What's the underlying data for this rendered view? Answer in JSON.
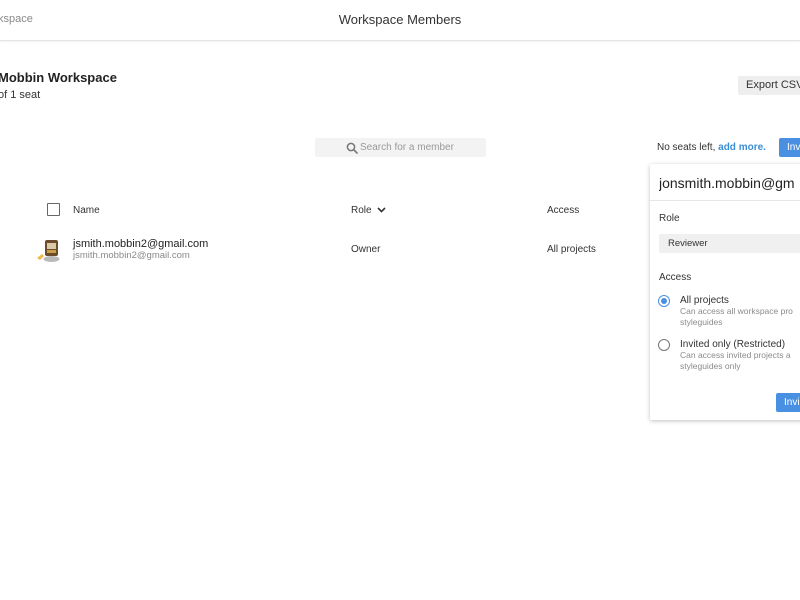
{
  "header": {
    "back_label": "kspace",
    "title": "Workspace Members"
  },
  "workspace": {
    "name": "Mobbin Workspace",
    "seats": "of 1 seat",
    "export_label": "Export CSV"
  },
  "search": {
    "placeholder": "Search for a member"
  },
  "seats_note": {
    "text": "No seats left,",
    "link": "add more."
  },
  "invite_button_label": "Invi",
  "table": {
    "columns": [
      "Name",
      "Role",
      "Access"
    ],
    "rows": [
      {
        "name": "jsmith.mobbin2@gmail.com",
        "email": "jsmith.mobbin2@gmail.com",
        "role": "Owner",
        "access": "All projects"
      }
    ]
  },
  "invite_popover": {
    "email_value": "jonsmith.mobbin@gm",
    "role_label": "Role",
    "role_value": "Reviewer",
    "access_label": "Access",
    "options": [
      {
        "title": "All projects",
        "description": "Can access all workspace pro styleguides",
        "selected": true
      },
      {
        "title": "Invited only (Restricted)",
        "description": "Can access invited projects a styleguides only",
        "selected": false
      }
    ],
    "invite_label": "Invi"
  },
  "colors": {
    "accent": "#4a90e2",
    "link": "#3b8ed6"
  }
}
